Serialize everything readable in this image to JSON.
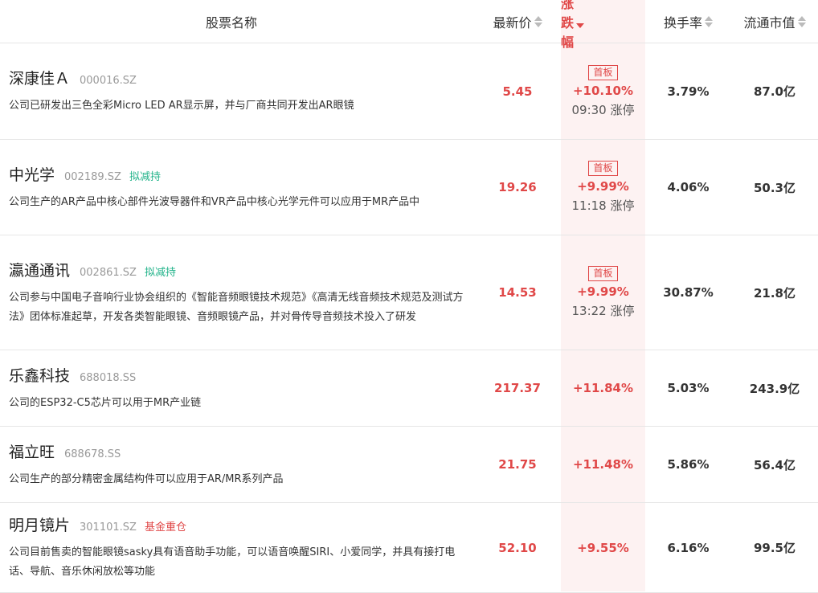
{
  "header": {
    "name": "股票名称",
    "price": "最新价",
    "change": "涨跌幅",
    "turnover": "换手率",
    "market_cap": "流通市值"
  },
  "colors": {
    "up": "#e04848",
    "tag_green": "#22b38a",
    "tag_red": "#e04848",
    "highlight_bg": "#fdf2f2"
  },
  "rows": [
    {
      "name": "深康佳Ａ",
      "code": "000016.SZ",
      "tag": "",
      "tag_color": "",
      "desc": "公司已研发出三色全彩Micro LED AR显示屏，并与厂商共同开发出AR眼镜",
      "price": "5.45",
      "badge": "首板",
      "change": "+10.10%",
      "limit": "09:30 涨停",
      "turnover": "3.79%",
      "market_cap": "87.0亿"
    },
    {
      "name": "中光学",
      "code": "002189.SZ",
      "tag": "拟减持",
      "tag_color": "#22b38a",
      "desc": "公司生产的AR产品中核心部件光波导器件和VR产品中核心光学元件可以应用于MR产品中",
      "price": "19.26",
      "badge": "首板",
      "change": "+9.99%",
      "limit": "11:18 涨停",
      "turnover": "4.06%",
      "market_cap": "50.3亿"
    },
    {
      "name": "瀛通通讯",
      "code": "002861.SZ",
      "tag": "拟减持",
      "tag_color": "#22b38a",
      "desc": "公司参与中国电子音响行业协会组织的《智能音频眼镜技术规范》《高清无线音频技术规范及测试方法》团体标准起草，开发各类智能眼镜、音频眼镜产品，并对骨传导音频技术投入了研发",
      "price": "14.53",
      "badge": "首板",
      "change": "+9.99%",
      "limit": "13:22 涨停",
      "turnover": "30.87%",
      "market_cap": "21.8亿"
    },
    {
      "name": "乐鑫科技",
      "code": "688018.SS",
      "tag": "",
      "tag_color": "",
      "desc": "公司的ESP32-C5芯片可以用于MR产业链",
      "price": "217.37",
      "badge": "",
      "change": "+11.84%",
      "limit": "",
      "turnover": "5.03%",
      "market_cap": "243.9亿"
    },
    {
      "name": "福立旺",
      "code": "688678.SS",
      "tag": "",
      "tag_color": "",
      "desc": "公司生产的部分精密金属结构件可以应用于AR/MR系列产品",
      "price": "21.75",
      "badge": "",
      "change": "+11.48%",
      "limit": "",
      "turnover": "5.86%",
      "market_cap": "56.4亿"
    },
    {
      "name": "明月镜片",
      "code": "301101.SZ",
      "tag": "基金重仓",
      "tag_color": "#e04848",
      "desc": "公司目前售卖的智能眼镜sasky具有语音助手功能，可以语音唤醒SIRI、小爱同学，并具有接打电话、导航、音乐休闲放松等功能",
      "price": "52.10",
      "badge": "",
      "change": "+9.55%",
      "limit": "",
      "turnover": "6.16%",
      "market_cap": "99.5亿"
    }
  ]
}
